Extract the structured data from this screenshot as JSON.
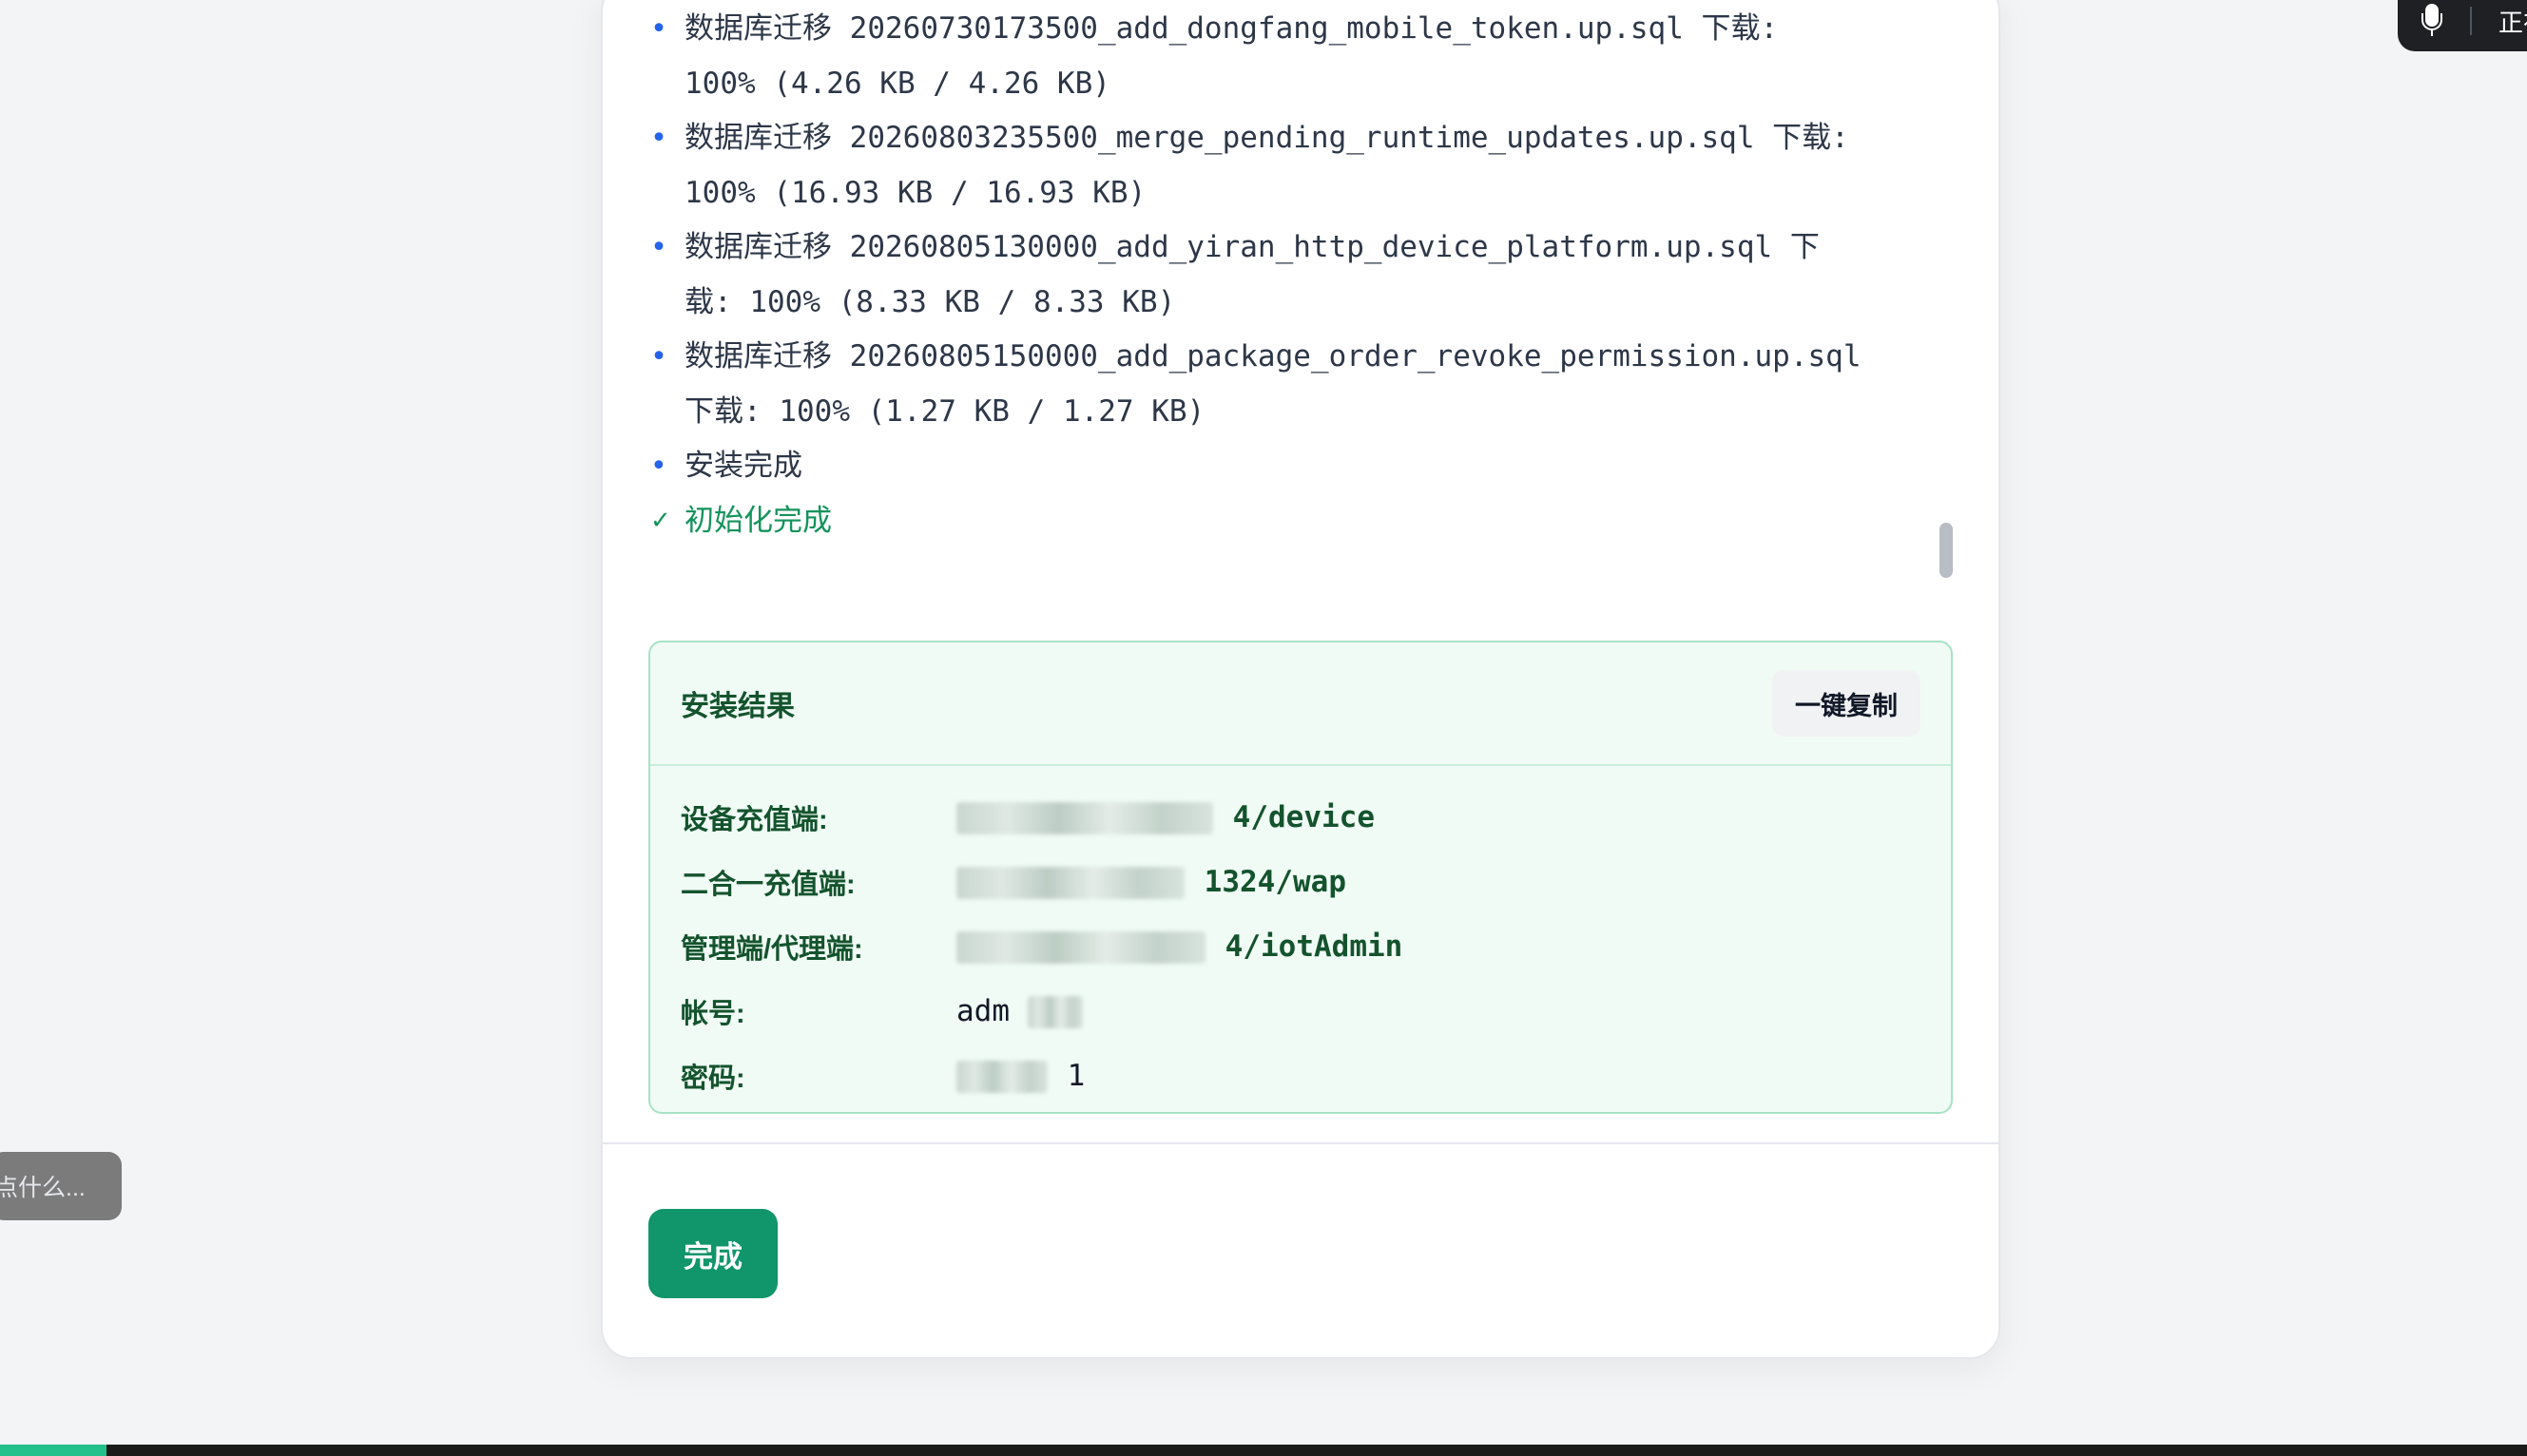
{
  "log": {
    "lines": [
      {
        "type": "info",
        "text": "数据库迁移 20260730173500_add_dongfang_mobile_token.up.sql 下载: 100% (4.26 KB / 4.26 KB)"
      },
      {
        "type": "info",
        "text": "数据库迁移 20260803235500_merge_pending_runtime_updates.up.sql 下载: 100% (16.93 KB / 16.93 KB)"
      },
      {
        "type": "info",
        "text": "数据库迁移 20260805130000_add_yiran_http_device_platform.up.sql 下载: 100% (8.33 KB / 8.33 KB)"
      },
      {
        "type": "info",
        "text": "数据库迁移 20260805150000_add_package_order_revoke_permission.up.sql 下载: 100% (1.27 KB / 1.27 KB)"
      },
      {
        "type": "plain",
        "text": "安装完成"
      },
      {
        "type": "success",
        "text": "初始化完成"
      }
    ],
    "bullet_icon": "•",
    "success_icon": "✓"
  },
  "result": {
    "title": "安装结果",
    "copy_label": "一键复制",
    "rows": [
      {
        "label": "设备充值端:",
        "value_suffix": "4/device"
      },
      {
        "label": "二合一充值端:",
        "value_suffix": "1324/wap"
      },
      {
        "label": "管理端/代理端:",
        "value_suffix": "4/iotAdmin"
      },
      {
        "label": "帐号:",
        "value_suffix": "adm"
      },
      {
        "label": "密码:",
        "value_suffix": "1"
      }
    ]
  },
  "footer": {
    "done_label": "完成"
  },
  "left_chip": {
    "text": "点什么..."
  },
  "voice": {
    "status_text": "正在",
    "icon": "microphone-icon"
  },
  "colors": {
    "accent_green": "#11956a",
    "bullet_blue": "#2563eb",
    "success_green": "#15935c"
  }
}
